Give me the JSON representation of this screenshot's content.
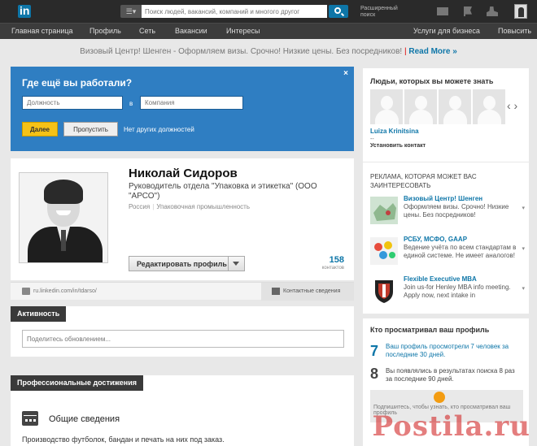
{
  "header": {
    "logo_text": "in",
    "search_placeholder": "Поиск людей, вакансий, компаний и многого другог",
    "advanced_search": "Расширенный поиск"
  },
  "nav": {
    "items": [
      "Главная страница",
      "Профиль",
      "Сеть",
      "Вакансии",
      "Интересы"
    ],
    "business": "Услуги для бизнеса",
    "upgrade": "Повысить"
  },
  "promo": {
    "text": "Визовый Центр! Шенген - Оформляем визы. Срочно! Низкие цены. Без посредников!",
    "separator": "|",
    "more": "Read More »"
  },
  "work_prompt": {
    "title": "Где ещё вы работали?",
    "close": "×",
    "position_placeholder": "Должность",
    "in_word": "в",
    "company_placeholder": "Компания",
    "next": "Далее",
    "skip": "Пропустить",
    "no_other": "Нет других должностей"
  },
  "profile": {
    "name": "Николай Сидоров",
    "headline": "Руководитель отдела \"Упаковка и этикетка\" (ООО \"АРСО\")",
    "location": "Россия",
    "separator": "|",
    "industry": "Упаковочная промышленность",
    "edit_button": "Редактировать профиль",
    "connections_count": "158",
    "connections_label": "контактов",
    "url": "ru.linkedin.com/in/tdarso/",
    "contact_info": "Контактные сведения"
  },
  "activity": {
    "title": "Активность",
    "placeholder": "Поделитесь обновлением..."
  },
  "background": {
    "title": "Профессиональные достижения",
    "summary_title": "Общие сведения",
    "summary_text": "Производство футболок, бандан и печать на них под заказ."
  },
  "pymk": {
    "title": "Людьи, которых вы можете знать",
    "arrows": "‹ ›",
    "person_name": "Luiza Krinitsina",
    "person_sub": "--",
    "connect": "Установить контакт"
  },
  "ads": {
    "title": "РЕКЛАМА, КОТОРАЯ МОЖЕТ ВАС ЗАИНТЕРЕСОВАТЬ",
    "items": [
      {
        "title": "Визовый Центр! Шенген",
        "body": "Оформляем визы. Срочно! Низкие цены. Без посредников!",
        "caret": "▾"
      },
      {
        "title": "РСБУ, МСФО, GAAP",
        "body": "Ведение учёта по всем стандартам в единой системе. Не имеет аналогов!",
        "caret": "▾"
      },
      {
        "title": "Flexible Executive MBA",
        "body": "Join us-for Henley MBA info meeting. Apply now, next intake in",
        "caret": "▾"
      }
    ]
  },
  "views": {
    "title": "Кто просматривал ваш профиль",
    "row1_num": "7",
    "row1_text": "Ваш профиль просмотрели 7 человек за последние 30 дней.",
    "row2_num": "8",
    "row2_text": "Вы появлялись в результатах поиска 8 раз за последние 90 дней.",
    "banner_text": "Подпишитесь, чтобы узнать, кто просматривал ваш профиль"
  },
  "watermark": "Postila.ru",
  "colors": {
    "brand": "#0e76a8",
    "topbar": "#2a2a2a",
    "prompt_panel": "#2f7ec2",
    "next_button": "#f5c217"
  }
}
